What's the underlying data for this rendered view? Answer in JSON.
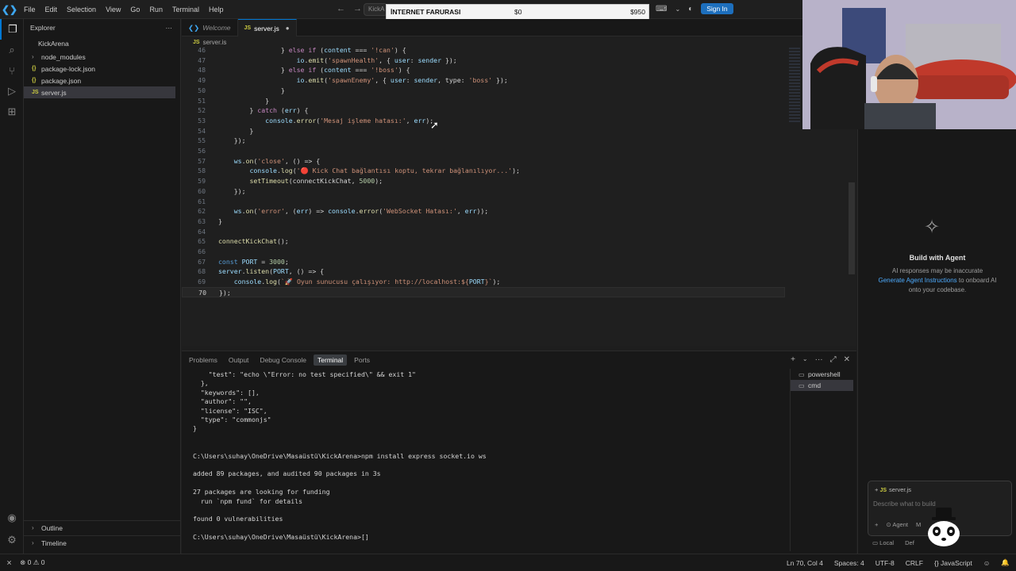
{
  "menu": [
    "File",
    "Edit",
    "Selection",
    "View",
    "Go",
    "Run",
    "Terminal",
    "Help"
  ],
  "command_center": "KickA",
  "promo_banner": {
    "title": "İNTERNET FARURASI",
    "start": "$0",
    "goal": "$950"
  },
  "sign_in_label": "Sign In",
  "explorer": {
    "header": "Explorer",
    "more_icon": "···",
    "root": "KickArena",
    "items": [
      {
        "label": "node_modules",
        "icon": "chevron-right"
      },
      {
        "label": "package-lock.json",
        "icon": "json"
      },
      {
        "label": "package.json",
        "icon": "json"
      },
      {
        "label": "server.js",
        "icon": "js",
        "selected": true
      }
    ],
    "outline": "Outline",
    "timeline": "Timeline"
  },
  "tabs": [
    {
      "label": "Welcome",
      "active": false
    },
    {
      "label": "server.js",
      "active": true,
      "dirty": true
    }
  ],
  "breadcrumb": "server.js",
  "code_lines": [
    {
      "n": "46",
      "text": "                } else if (content === '!can') {"
    },
    {
      "n": "47",
      "text": "                    io.emit('spawnHealth', { user: sender });"
    },
    {
      "n": "48",
      "text": "                } else if (content === '!boss') {"
    },
    {
      "n": "49",
      "text": "                    io.emit('spawnEnemy', { user: sender, type: 'boss' });"
    },
    {
      "n": "50",
      "text": "                }"
    },
    {
      "n": "51",
      "text": "            }"
    },
    {
      "n": "52",
      "text": "        } catch (err) {"
    },
    {
      "n": "53",
      "text": "            console.error('Mesaj işleme hatası:', err);"
    },
    {
      "n": "54",
      "text": "        }"
    },
    {
      "n": "55",
      "text": "    });"
    },
    {
      "n": "56",
      "text": ""
    },
    {
      "n": "57",
      "text": "    ws.on('close', () => {"
    },
    {
      "n": "58",
      "text": "        console.log('🔴 Kick Chat bağlantısı koptu, tekrar bağlanılıyor...');"
    },
    {
      "n": "59",
      "text": "        setTimeout(connectKickChat, 5000);"
    },
    {
      "n": "60",
      "text": "    });"
    },
    {
      "n": "61",
      "text": ""
    },
    {
      "n": "62",
      "text": "    ws.on('error', (err) => console.error('WebSocket Hatası:', err));"
    },
    {
      "n": "63",
      "text": "}"
    },
    {
      "n": "64",
      "text": ""
    },
    {
      "n": "65",
      "text": "connectKickChat();"
    },
    {
      "n": "66",
      "text": ""
    },
    {
      "n": "67",
      "text": "const PORT = 3000;"
    },
    {
      "n": "68",
      "text": "server.listen(PORT, () => {"
    },
    {
      "n": "69",
      "text": "    console.log(`🚀 Oyun sunucusu çalışıyor: http://localhost:${PORT}`);"
    },
    {
      "n": "70",
      "text": "});"
    }
  ],
  "panel_tabs": [
    "Problems",
    "Output",
    "Debug Console",
    "Terminal",
    "Ports"
  ],
  "terminal_lines": [
    "    \"test\": \"echo \\\"Error: no test specified\\\" && exit 1\"",
    "  },",
    "  \"keywords\": [],",
    "  \"author\": \"\",",
    "  \"license\": \"ISC\",",
    "  \"type\": \"commonjs\"",
    "}",
    "",
    "",
    "C:\\Users\\suhay\\OneDrive\\Masaüstü\\KickArena>npm install express socket.io ws",
    "",
    "added 89 packages, and audited 90 packages in 3s",
    "",
    "27 packages are looking for funding",
    "  run `npm fund` for details",
    "",
    "found 0 vulnerabilities",
    "",
    "C:\\Users\\suhay\\OneDrive\\Masaüstü\\KickArena>[]"
  ],
  "terminals": [
    {
      "label": "powershell",
      "active": false
    },
    {
      "label": "cmd",
      "active": true
    }
  ],
  "chat": {
    "heading": "Build with Agent",
    "note_1": "AI responses may be inaccurate",
    "link": "Generate Agent Instructions",
    "note_2": "to onboard AI",
    "note_3": "onto your codebase.",
    "context_file": "server.js",
    "placeholder": "Describe what to build",
    "agent_label": "Agent",
    "model_label": "M",
    "local_label": "Local",
    "default_label": "Def"
  },
  "status": {
    "errors": "0",
    "warnings": "0",
    "position": "Ln 70, Col 4",
    "spaces": "Spaces: 4",
    "encoding": "UTF-8",
    "eol": "CRLF",
    "language": "{} JavaScript"
  },
  "colors": {
    "accent": "#0078d4",
    "keyword": "#569cd6",
    "function": "#dcdcaa",
    "string": "#ce9178",
    "number": "#b5cea8",
    "variable": "#9cdcfe",
    "control": "#c586c0"
  }
}
